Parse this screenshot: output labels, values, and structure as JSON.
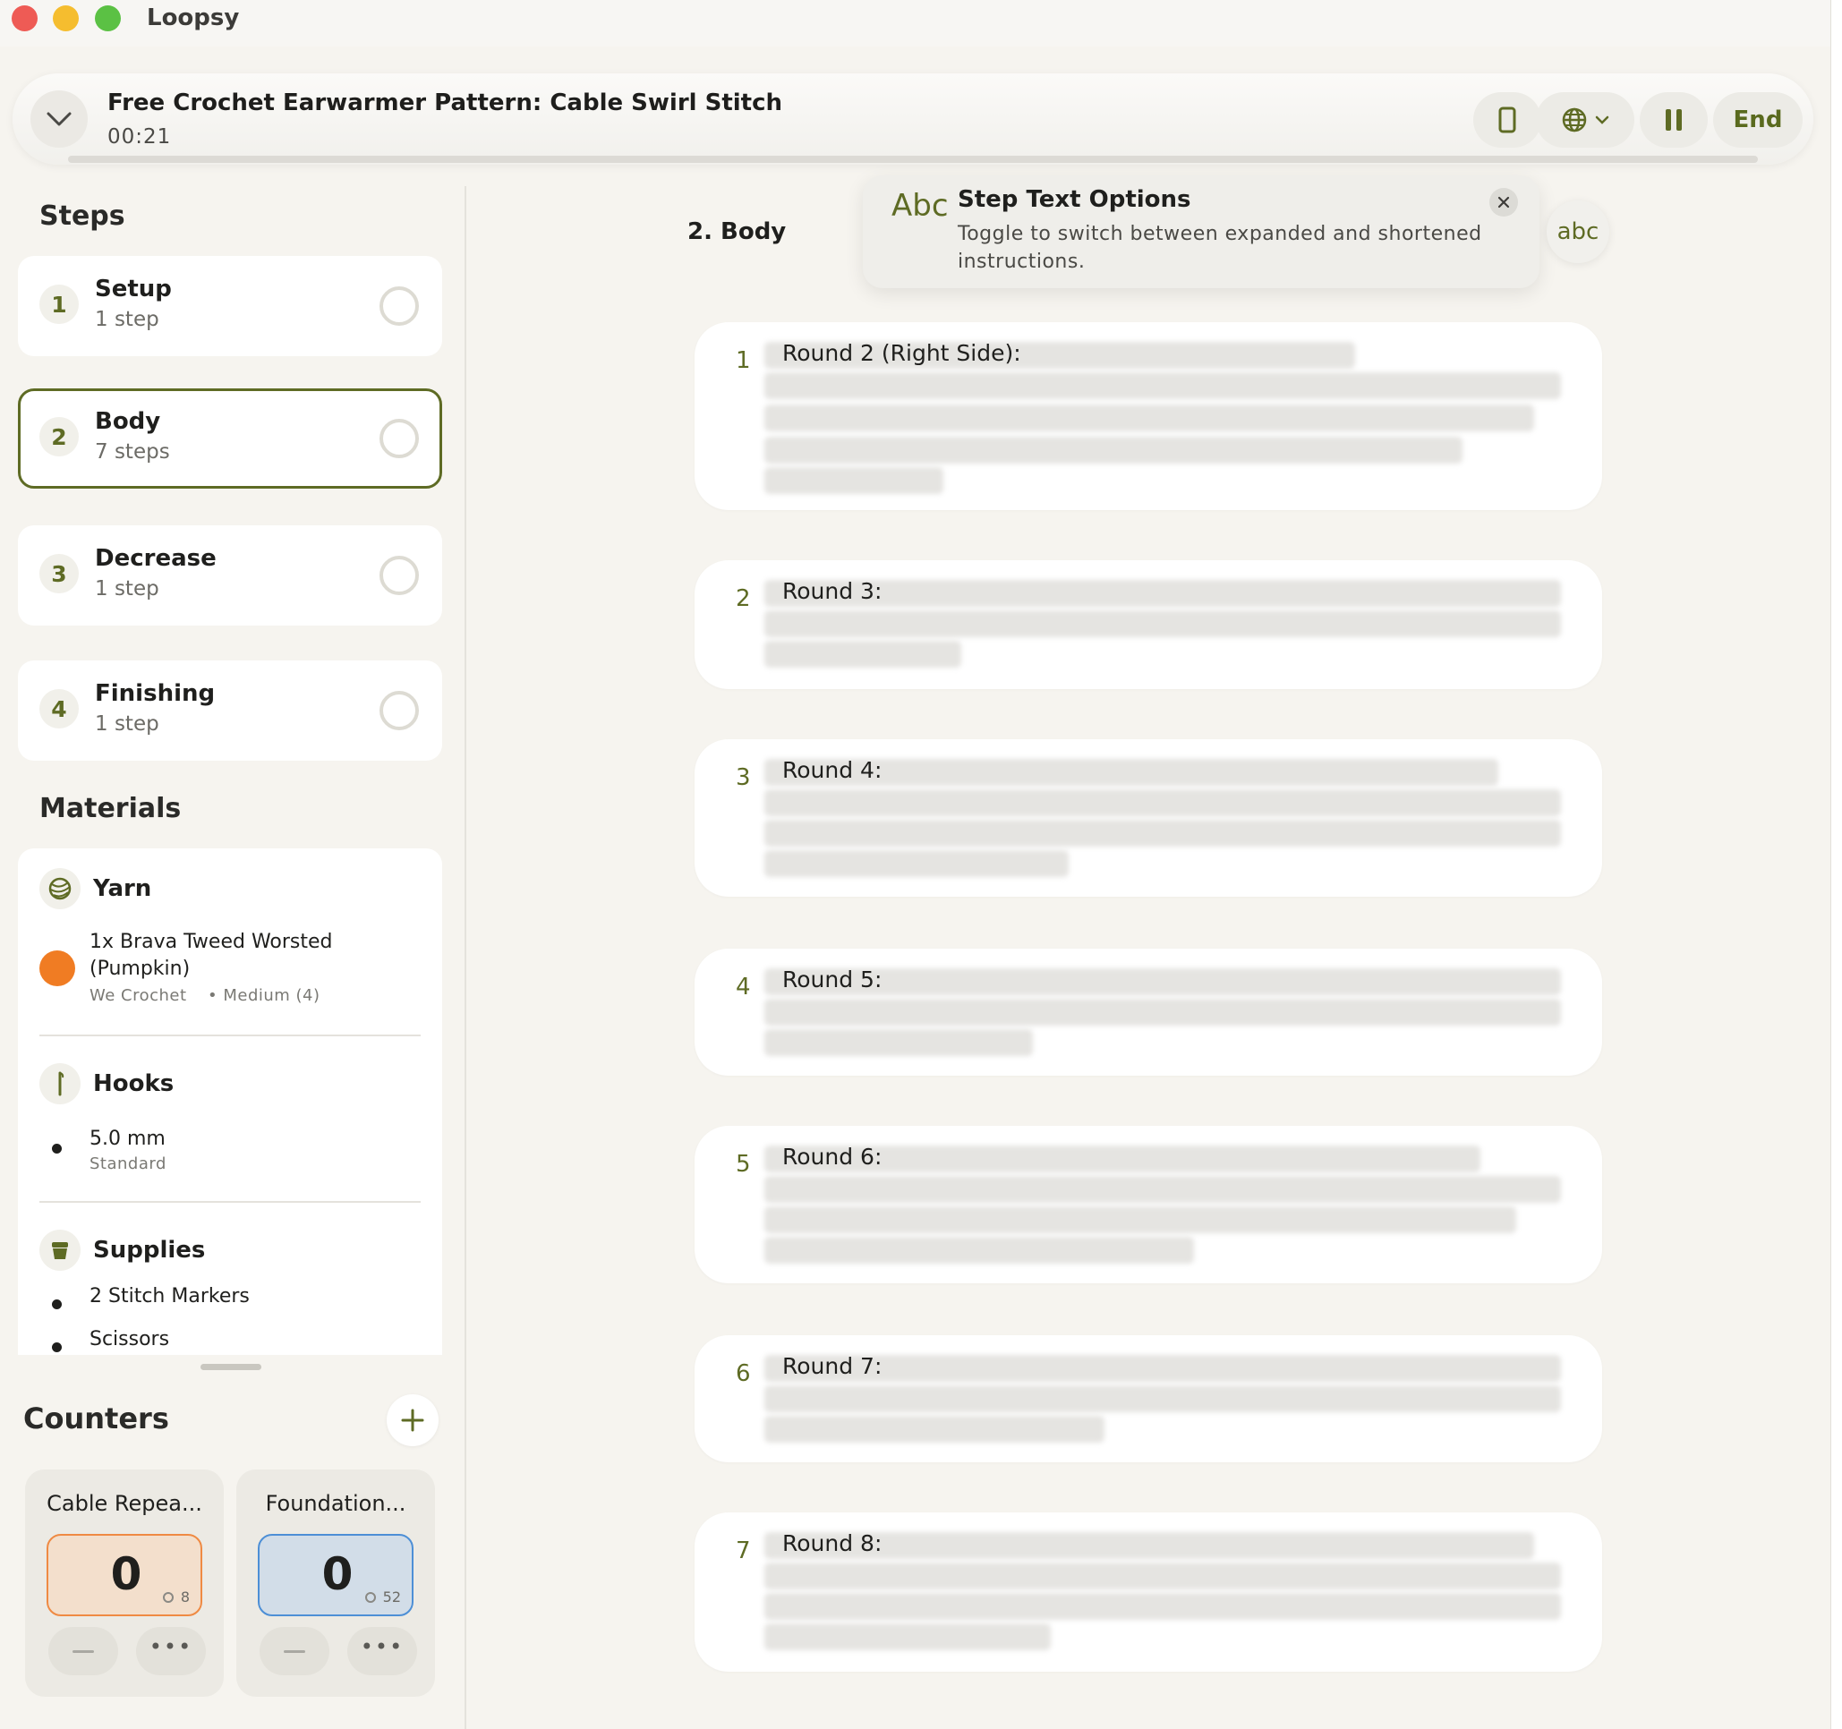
{
  "app": {
    "title": "Loopsy"
  },
  "header": {
    "pattern_title": "Free Crochet Earwarmer Pattern: Cable Swirl Stitch",
    "timer": "00:21",
    "end_label": "End"
  },
  "sidebar": {
    "steps_heading": "Steps",
    "steps": [
      {
        "number": "1",
        "name": "Setup",
        "count": "1 step"
      },
      {
        "number": "2",
        "name": "Body",
        "count": "7 steps"
      },
      {
        "number": "3",
        "name": "Decrease",
        "count": "1 step"
      },
      {
        "number": "4",
        "name": "Finishing",
        "count": "1 step"
      }
    ],
    "materials_heading": "Materials",
    "materials": {
      "yarn": {
        "title": "Yarn",
        "line1": "1x Brava Tweed Worsted",
        "line2": "(Pumpkin)",
        "brand": "We Crochet",
        "weight": "• Medium (4)",
        "color": "#f07c23"
      },
      "hooks": {
        "title": "Hooks",
        "size": "5.0 mm",
        "type": "Standard"
      },
      "supplies": {
        "title": "Supplies",
        "items": [
          "2 Stitch Markers",
          "Scissors"
        ]
      }
    }
  },
  "counters": {
    "heading": "Counters",
    "items": [
      {
        "name": "Cable Repea...",
        "value": "0",
        "target": "8",
        "color": "orange"
      },
      {
        "name": "Foundation...",
        "value": "0",
        "target": "52",
        "color": "blue"
      }
    ]
  },
  "main": {
    "section_title": "2. Body",
    "rounds": [
      {
        "number": "1",
        "label": "Round 2 (Right Side):"
      },
      {
        "number": "2",
        "label": "Round 3:"
      },
      {
        "number": "3",
        "label": "Round 4:"
      },
      {
        "number": "4",
        "label": "Round 5:"
      },
      {
        "number": "5",
        "label": "Round 6:"
      },
      {
        "number": "6",
        "label": "Round 7:"
      },
      {
        "number": "7",
        "label": "Round 8:"
      }
    ]
  },
  "tooltip": {
    "icon_text": "Abc",
    "title": "Step Text Options",
    "description": "Toggle to switch between expanded and shortened instructions.",
    "toggle_label": "abc"
  },
  "colors": {
    "accent": "#5e6b24",
    "orange_counter": "#ef8a43",
    "blue_counter": "#4d8fd6"
  }
}
